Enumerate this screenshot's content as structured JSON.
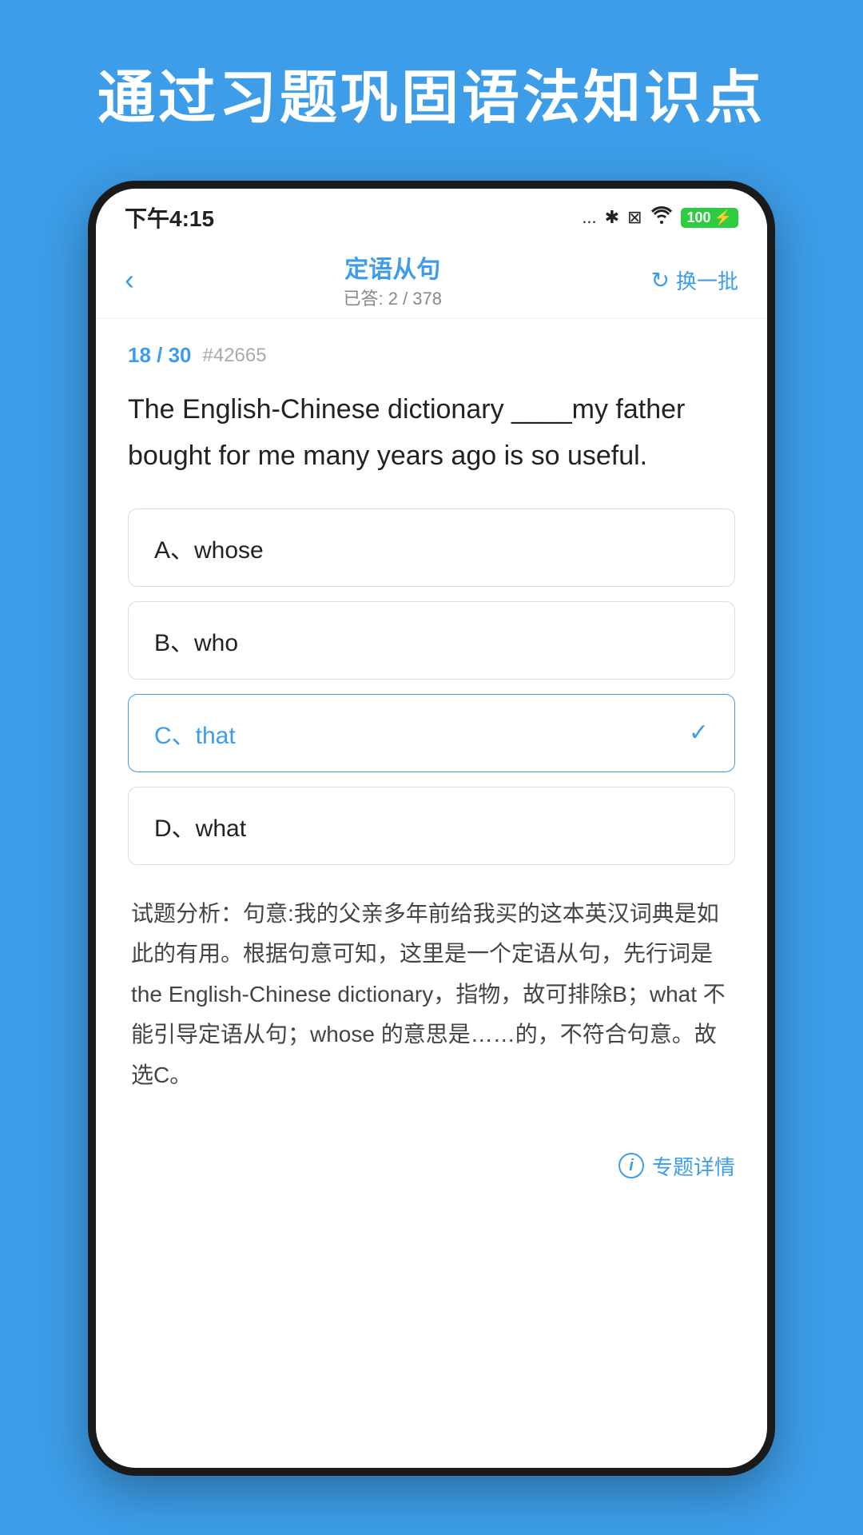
{
  "page": {
    "title": "通过习题巩固语法知识点",
    "background_color": "#3d9de8"
  },
  "status_bar": {
    "time": "下午4:15",
    "dots": "...",
    "bluetooth": "✱",
    "battery_label": "100",
    "wifi": "wifi"
  },
  "nav": {
    "back_icon": "‹",
    "title": "定语从句",
    "subtitle": "已答: 2 / 378",
    "refresh_label": "换一批"
  },
  "question": {
    "progress": "18 / 30",
    "id": "#42665",
    "text": "The English-Chinese dictionary ____my father bought for me many years ago is so useful."
  },
  "options": [
    {
      "label": "A、whose",
      "id": "A",
      "selected": false
    },
    {
      "label": "B、who",
      "id": "B",
      "selected": false
    },
    {
      "label": "C、that",
      "id": "C",
      "selected": true
    },
    {
      "label": "D、what",
      "id": "D",
      "selected": false
    }
  ],
  "analysis": {
    "label": "试题分析：",
    "text": "句意:我的父亲多年前给我买的这本英汉词典是如此的有用。根据句意可知，这里是一个定语从句，先行词是the English-Chinese dictionary，指物，故可排除B；what 不能引导定语从句；whose 的意思是……的，不符合句意。故选C。"
  },
  "footer": {
    "topic_detail_label": "专题详情",
    "info_icon": "i"
  }
}
